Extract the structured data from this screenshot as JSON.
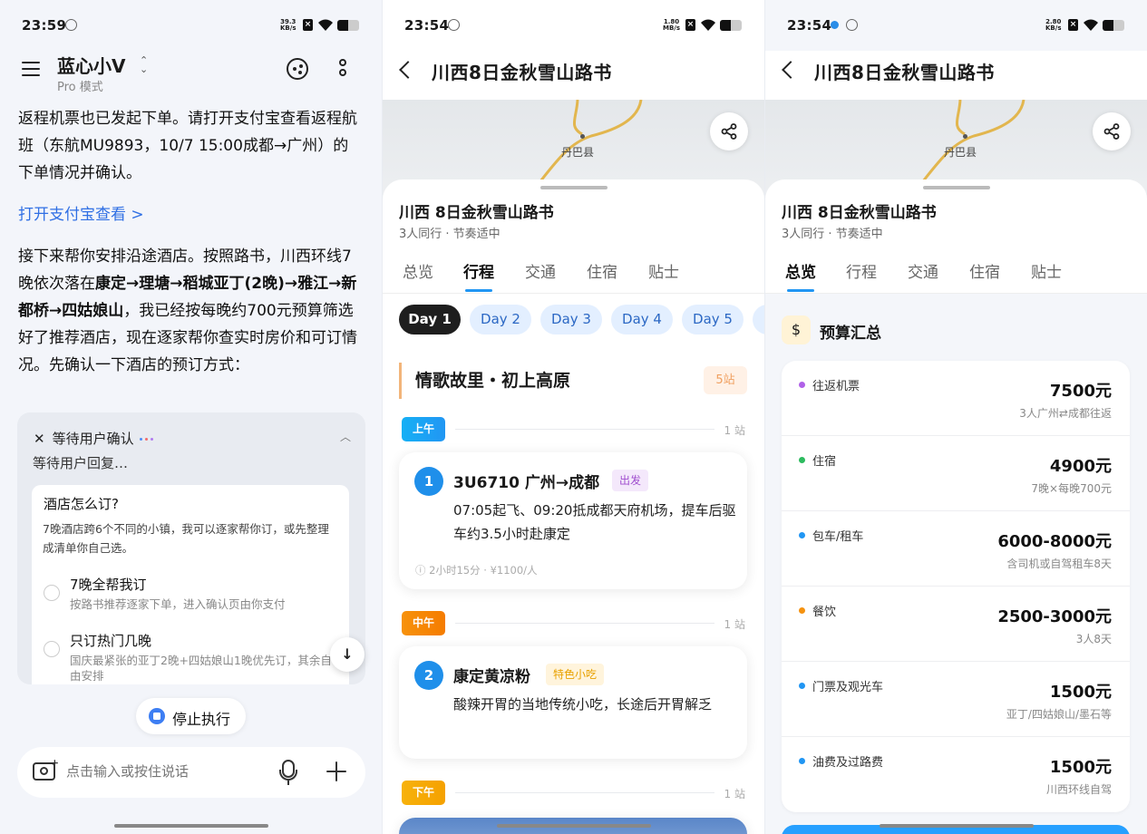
{
  "colors": {
    "accent": "#2196f3",
    "link": "#2f6fe4",
    "dark_pill": "#1e1e1e",
    "morning": "#19a3f0",
    "noon": "#f57c00",
    "afternoon": "#f5a100"
  },
  "panel1": {
    "status": {
      "time": "23:59",
      "speed": "39.3",
      "unit": "KB/s",
      "battery_level": 0.5
    },
    "header": {
      "title": "蓝心小V",
      "subtitle": "Pro 模式",
      "icons": [
        "menu-icon",
        "chevron-icon",
        "face-icon",
        "more-icon"
      ]
    },
    "chat": {
      "para1": "返程机票也已发起下单。请打开支付宝查看返程航班（东航MU9893，10/7 15:00成都→广州）的下单情况并确认。",
      "link": "打开支付宝查看 >",
      "para2_a": "接下来帮你安排沿途酒店。按照路书，川西环线7晚依次落在",
      "para2_b": "康定→理塘→稻城亚丁(2晚)→雅江→新都桥→四姑娘山",
      "para2_c": "，我已经按每晚约700元预算筛选好了推荐酒店，现在逐家帮你查实时房价和可订情况。先确认一下酒店的预订方式："
    },
    "task": {
      "header": "等待用户确认",
      "subheader": "等待用户回复…",
      "question": "酒店怎么订?",
      "desc": "7晚酒店跨6个不同的小镇，我可以逐家帮你订，或先整理成清单你自己选。",
      "options": [
        {
          "label": "7晚全帮我订",
          "desc": "按路书推荐逐家下单，进入确认页由你支付"
        },
        {
          "label": "只订热门几晚",
          "desc": "国庆最紧张的亚丁2晚+四姑娘山1晚优先订，其余自由安排"
        }
      ]
    },
    "stop_label": "停止执行",
    "input": {
      "placeholder": "点击输入或按住说话"
    }
  },
  "panel2": {
    "status": {
      "time": "23:54",
      "speed": "1.80",
      "unit": "MB/s",
      "battery_level": 0.5
    },
    "nav_title": "川西8日金秋雪山路书",
    "map": {
      "town": "丹巴县"
    },
    "sheet": {
      "title": "川西 8日金秋雪山路书",
      "subtitle": "3人同行 · 节奏适中"
    },
    "tabs": [
      "总览",
      "行程",
      "交通",
      "住宿",
      "贴士"
    ],
    "active_tab": "行程",
    "days": [
      "Day 1",
      "Day 2",
      "Day 3",
      "Day 4",
      "Day 5"
    ],
    "day_title": "情歌故里・初上高原",
    "day_count": "5站",
    "slots": [
      {
        "label": "上午",
        "count": "1 站"
      },
      {
        "label": "中午",
        "count": "1 站"
      },
      {
        "label": "下午",
        "count": "1 站"
      }
    ],
    "stops": [
      {
        "num": "1",
        "title": "3U6710 广州→成都",
        "tag": "出发",
        "desc": "07:05起飞、09:20抵成都天府机场，提车后驱车约3.5小时赴康定",
        "meta": "ⓘ 2小时15分 · ¥1100/人"
      },
      {
        "num": "2",
        "title": "康定黄凉粉",
        "tag": "特色小吃",
        "desc": "酸辣开胃的当地传统小吃，长途后开胃解乏"
      }
    ]
  },
  "panel3": {
    "status": {
      "time": "23:54",
      "speed": "2.80",
      "unit": "KB/s",
      "battery_level": 0.5
    },
    "nav_title": "川西8日金秋雪山路书",
    "map": {
      "town": "丹巴县"
    },
    "sheet": {
      "title": "川西 8日金秋雪山路书",
      "subtitle": "3人同行 · 节奏适中"
    },
    "tabs": [
      "总览",
      "行程",
      "交通",
      "住宿",
      "贴士"
    ],
    "active_tab": "总览",
    "budget_title": "预算汇总",
    "budget": [
      {
        "name": "往返机票",
        "value": "7500元",
        "sub": "3人广州⇄成都往返",
        "color": "#b061e8"
      },
      {
        "name": "住宿",
        "value": "4900元",
        "sub": "7晚×每晚700元",
        "color": "#2dbb5f"
      },
      {
        "name": "包车/租车",
        "value": "6000-8000元",
        "sub": "含司机或自驾租车8天",
        "color": "#2196f3"
      },
      {
        "name": "餐饮",
        "value": "2500-3000元",
        "sub": "3人8天",
        "color": "#f5920f"
      },
      {
        "name": "门票及观光车",
        "value": "1500元",
        "sub": "亚丁/四姑娘山/墨石等",
        "color": "#2196f3"
      },
      {
        "name": "油费及过路费",
        "value": "1500元",
        "sub": "川西环线自驾",
        "color": "#2196f3"
      }
    ]
  }
}
